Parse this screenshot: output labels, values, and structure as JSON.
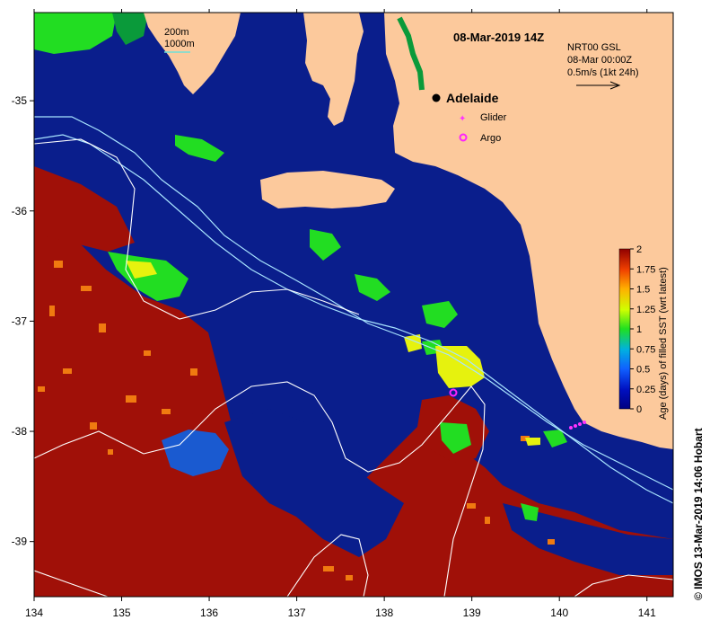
{
  "title": "08-Mar-2019 14Z",
  "scale": {
    "line1": "200m",
    "line2": "1000m"
  },
  "info": {
    "line1": "NRT00 GSL",
    "line2": "08-Mar 00:00Z",
    "line3": "0.5m/s (1kt 24h)"
  },
  "places": [
    {
      "name": "Adelaide",
      "lon": 138.6,
      "lat": -34.92
    }
  ],
  "legend_markers": [
    {
      "label": "Glider",
      "color": "#ff33ff"
    },
    {
      "label": "Argo",
      "color": "#ff22ff"
    }
  ],
  "colorbar": {
    "label": "Age (days) of filled SST (wrt latest)",
    "ticks": [
      "2",
      "1.75",
      "1.5",
      "1.25",
      "1",
      "0.75",
      "0.5",
      "0.25",
      "0"
    ],
    "range": [
      0,
      2
    ]
  },
  "credit": "© IMOS 13-Mar-2019 14:06 Hobart",
  "axes": {
    "x_ticks": [
      "134",
      "135",
      "136",
      "137",
      "138",
      "139",
      "140",
      "141"
    ],
    "y_ticks": [
      "-35",
      "-36",
      "-37",
      "-38",
      "-39"
    ],
    "lon_range": [
      134,
      141.3
    ],
    "lat_range": [
      -39.5,
      -34.2
    ]
  },
  "colors": {
    "land": "#fcc99c",
    "ocean_recent": "#0a1e8c",
    "old": "#a01008",
    "contour": "#a8e4ff"
  },
  "glider_track": [
    [
      140.15,
      -37.94
    ],
    [
      140.2,
      -37.93
    ],
    [
      140.25,
      -37.92
    ],
    [
      140.3,
      -37.91
    ]
  ],
  "argo_float": {
    "lon": 138.78,
    "lat": -37.63
  }
}
